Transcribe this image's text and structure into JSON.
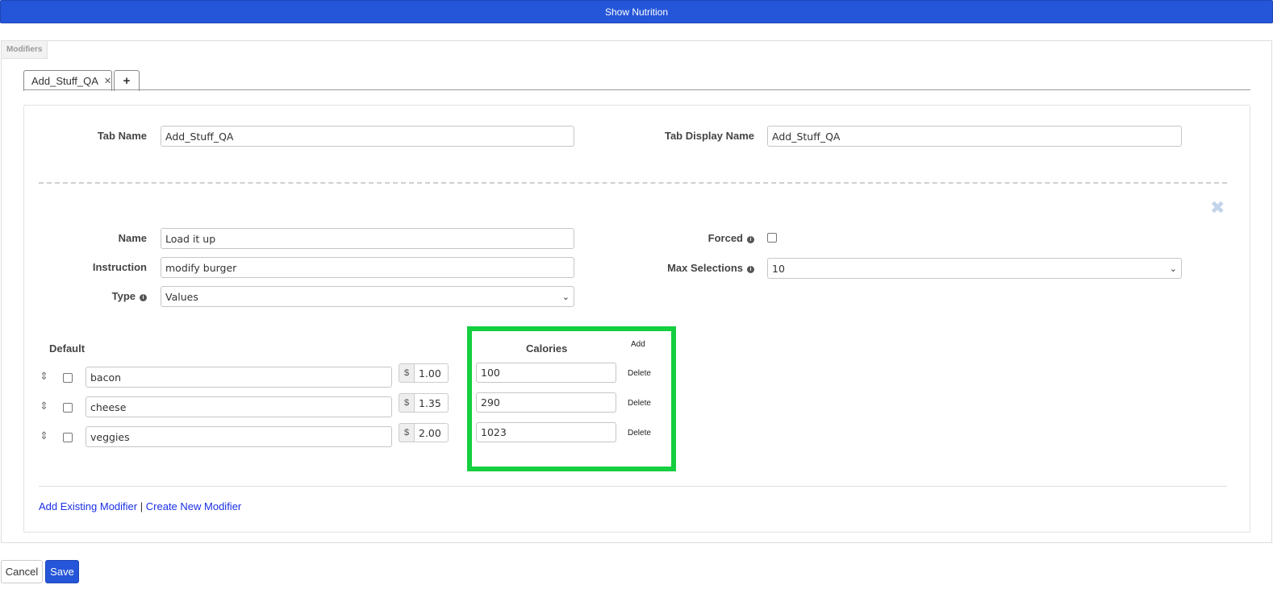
{
  "header": {
    "show_nutrition_label": "Show Nutrition"
  },
  "panel": {
    "label": "Modifiers"
  },
  "tabs": {
    "items": [
      {
        "label": "Add_Stuff_QA",
        "close_glyph": "✕"
      }
    ],
    "add_glyph": "+"
  },
  "tab_settings": {
    "tab_name_label": "Tab Name",
    "tab_name_value": "Add_Stuff_QA",
    "tab_display_name_label": "Tab Display Name",
    "tab_display_name_value": "Add_Stuff_QA"
  },
  "modifier": {
    "remove_glyph": "✖",
    "name_label": "Name",
    "name_value": "Load it up",
    "instruction_label": "Instruction",
    "instruction_value": "modify burger",
    "type_label": "Type",
    "type_value": "Values",
    "forced_label": "Forced",
    "forced_checked": false,
    "max_selections_label": "Max Selections",
    "max_selections_value": "10",
    "info_glyph": "i"
  },
  "values_table": {
    "default_header": "Default",
    "calories_header": "Calories",
    "add_label": "Add",
    "currency_symbol": "$",
    "delete_label": "Delete",
    "drag_glyph": "⇕",
    "rows": [
      {
        "name": "bacon",
        "price": "1.00",
        "calories": "100",
        "default_checked": false
      },
      {
        "name": "cheese",
        "price": "1.35",
        "calories": "290",
        "default_checked": false
      },
      {
        "name": "veggies",
        "price": "2.00",
        "calories": "1023",
        "default_checked": false
      }
    ]
  },
  "links": {
    "add_existing": "Add Existing Modifier",
    "separator": "|",
    "create_new": "Create New Modifier"
  },
  "footer": {
    "cancel_label": "Cancel",
    "save_label": "Save"
  },
  "colors": {
    "primary_blue": "#2556d9",
    "highlight_green": "#14cf3f",
    "link_blue": "#1a2fe6"
  },
  "icons": {
    "tab_close": "close-icon",
    "tab_add": "plus-icon",
    "remove_modifier": "close-icon",
    "info": "info-icon",
    "drag": "drag-handle-icon",
    "select_caret": "chevron-down-icon"
  }
}
